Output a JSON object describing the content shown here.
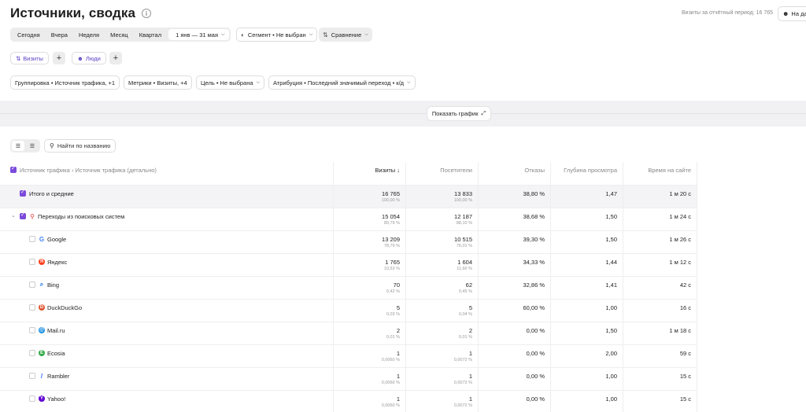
{
  "header": {
    "title": "Источники, сводка",
    "visits_period": "Визиты за отчётный период: 16 765",
    "top_button": "На да"
  },
  "period": {
    "items": [
      "Сегодня",
      "Вчера",
      "Неделя",
      "Месяц",
      "Квартал"
    ],
    "date_range": "1 янв — 31 мая"
  },
  "segment": {
    "label": "Сегмент • Не выбран"
  },
  "compare": {
    "label": "Сравнение"
  },
  "segments": {
    "visits": "Визиты",
    "people": "Люди"
  },
  "settings": {
    "grouping": "Группировка • Источник трафика, +1",
    "metrics": "Метрики • Визиты, +4",
    "goal": "Цель • Не выбрана",
    "attribution": "Атрибуция • Последний значимый переход • к/д"
  },
  "chart_toggle": {
    "label": "Показать график"
  },
  "search": {
    "placeholder": "Найти по названию"
  },
  "table": {
    "dimension_header": "Источник трафика › Источник трафика (детально)",
    "columns": [
      "Визиты ↓",
      "Посетители",
      "Отказы",
      "Глубина просмотра",
      "Время на сайте"
    ],
    "total": {
      "label": "Итого и средние",
      "visits": "16 765",
      "visits_pct": "100,00 %",
      "visitors": "13 833",
      "visitors_pct": "100,00 %",
      "bounce": "38,80 %",
      "depth": "1,47",
      "time": "1 м 20 с"
    },
    "group": {
      "label": "Переходы из поисковых систем",
      "visits": "15 054",
      "visits_pct": "89,79 %",
      "visitors": "12 187",
      "visitors_pct": "88,10 %",
      "bounce": "38,68 %",
      "depth": "1,50",
      "time": "1 м 24 с"
    },
    "rows": [
      {
        "label": "Google",
        "icon": "google-icon",
        "icon_char": "G",
        "icon_color": "#ffffff",
        "icon_text": "#4285f4",
        "visits": "13 209",
        "visits_pct": "78,79 %",
        "visitors": "10 515",
        "visitors_pct": "76,01 %",
        "bounce": "39,30 %",
        "depth": "1,50",
        "time": "1 м 26 с"
      },
      {
        "label": "Яндекс",
        "icon": "yandex-icon",
        "icon_char": "Я",
        "icon_color": "#fc3f1d",
        "icon_text": "#ffffff",
        "visits": "1 765",
        "visits_pct": "10,53 %",
        "visitors": "1 604",
        "visitors_pct": "11,60 %",
        "bounce": "34,33 %",
        "depth": "1,44",
        "time": "1 м 12 с"
      },
      {
        "label": "Bing",
        "icon": "bing-icon",
        "icon_char": "⌕",
        "icon_color": "#ffffff",
        "icon_text": "#1a73e8",
        "visits": "70",
        "visits_pct": "0,42 %",
        "visitors": "62",
        "visitors_pct": "0,45 %",
        "bounce": "32,86 %",
        "depth": "1,41",
        "time": "42 с"
      },
      {
        "label": "DuckDuckGo",
        "icon": "duckduckgo-icon",
        "icon_char": "D",
        "icon_color": "#de5833",
        "icon_text": "#ffffff",
        "visits": "5",
        "visits_pct": "0,03 %",
        "visitors": "5",
        "visitors_pct": "0,04 %",
        "bounce": "60,00 %",
        "depth": "1,00",
        "time": "16 с"
      },
      {
        "label": "Mail.ru",
        "icon": "mailru-icon",
        "icon_char": "@",
        "icon_color": "#168de2",
        "icon_text": "#ffffff",
        "visits": "2",
        "visits_pct": "0,01 %",
        "visitors": "2",
        "visitors_pct": "0,01 %",
        "bounce": "0,00 %",
        "depth": "1,50",
        "time": "1 м 18 с"
      },
      {
        "label": "Ecosia",
        "icon": "ecosia-icon",
        "icon_char": "E",
        "icon_color": "#36ab4a",
        "icon_text": "#ffffff",
        "visits": "1",
        "visits_pct": "0,0060 %",
        "visitors": "1",
        "visitors_pct": "0,0072 %",
        "bounce": "0,00 %",
        "depth": "2,00",
        "time": "59 с"
      },
      {
        "label": "Rambler",
        "icon": "rambler-icon",
        "icon_char": "/",
        "icon_color": "#ffffff",
        "icon_text": "#315efb",
        "visits": "1",
        "visits_pct": "0,0060 %",
        "visitors": "1",
        "visitors_pct": "0,0072 %",
        "bounce": "0,00 %",
        "depth": "1,00",
        "time": "15 с"
      },
      {
        "label": "Yahoo!",
        "icon": "yahoo-icon",
        "icon_char": "Y",
        "icon_color": "#6001d2",
        "icon_text": "#ffffff",
        "visits": "1",
        "visits_pct": "0,0060 %",
        "visitors": "1",
        "visitors_pct": "0,0072 %",
        "bounce": "0,00 %",
        "depth": "1,00",
        "time": "15 с"
      }
    ]
  }
}
